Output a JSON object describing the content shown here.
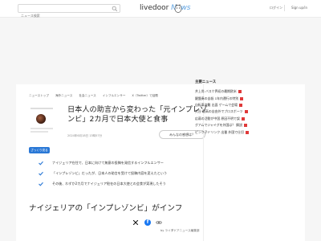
{
  "header": {
    "search_placeholder": "ニュース検索",
    "logo_main": "livedoor",
    "logo_news": "News",
    "login": "ログイン",
    "register": "Sign up/in"
  },
  "breadcrumb": [
    "ニューストップ",
    "海外ニュース",
    "社会ニュース",
    "インフルエンサー",
    "X（Twitter）で話題"
  ],
  "article": {
    "title": "日本人の助言から変わった「元インプレゾンビ」2カ月で日本大使と食事",
    "date": "2024年6月18日 13時57分",
    "minds_button": "みんなの感想は？",
    "tag": "ざっくり見る",
    "source": "by ライブドアニュース編集部",
    "points": [
      "ナイジェリア在住で、日本に向けて無意の投稿を発信するインフルエンサー",
      "「インプレゾンビ」だったが、日本人の助言を受けて投稿内容を変えたという",
      "その後、わずか2カ月でナイジェリア駐在の日本大使との会食が実現したそう"
    ],
    "subheading": "ナイジェリアの「インプレゾンビ」がインフ"
  },
  "sidebar": {
    "title": "主要ニュース",
    "items": [
      "井上尚 バスケ界初の最期欧米",
      "鍵盤奏の自殺 1年内運行の特別",
      "自転車盗難 出面 ゲームで会場",
      "大谷 最高の自由外でプロスポーツ",
      "応募の活動が中国 原因不明で誤",
      "グアムでジャイグを外国は？ 解説",
      "ピンク子ドリンク 出番 外国で仕切"
    ]
  },
  "colors": {
    "accent_blue": "#2a78d6",
    "news_blue": "#5aa0e0",
    "facebook": "#1877f2",
    "badge_red": "#e03a3a"
  }
}
